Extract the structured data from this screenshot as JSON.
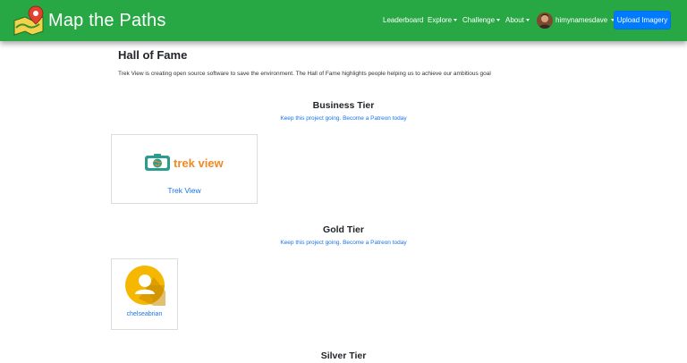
{
  "navbar": {
    "brand": "Map the Paths",
    "items": [
      {
        "label": "Leaderboard",
        "dropdown": false
      },
      {
        "label": "Explore",
        "dropdown": true
      },
      {
        "label": "Challenge",
        "dropdown": true
      },
      {
        "label": "About",
        "dropdown": true
      }
    ],
    "user": {
      "name": "himynamesdave"
    },
    "upload_label": "Upload Imagery"
  },
  "page": {
    "title": "Hall of Fame",
    "intro": "Trek View is creating open source software to save the environment. The Hall of Fame highlights people helping us to achieve our ambitious goal"
  },
  "tiers": [
    {
      "title": "Business Tier",
      "cta": "Keep this project going. Become a Patreon today",
      "members": [
        {
          "name": "Trek View",
          "logo_text": "trek view"
        }
      ]
    },
    {
      "title": "Gold Tier",
      "cta": "Keep this project going. Become a Patreon today",
      "members": [
        {
          "name": "chelseabrian"
        }
      ]
    },
    {
      "title": "Silver Tier"
    }
  ],
  "colors": {
    "navbar": "#28a745",
    "primary": "#007bff",
    "link": "#1a73e8",
    "trek_teal": "#2a9d8f",
    "trek_orange": "#f08a24",
    "avatar_yellow": "#f5b700"
  }
}
